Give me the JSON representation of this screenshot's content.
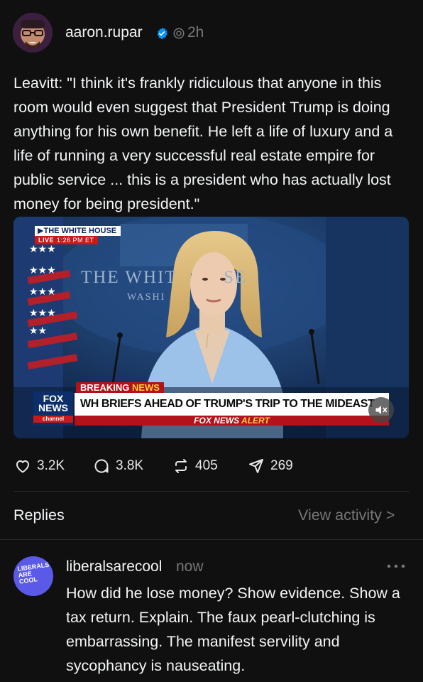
{
  "post": {
    "username": "aaron.rupar",
    "timestamp": "2h",
    "text": "Leavitt: \"I think it's frankly ridiculous that anyone in this room would even suggest that President Trump is doing anything for his own benefit. He left a life of luxury and a life of running a very successful real estate empire for public service ... this is a president who has actually lost money for being president.\"",
    "verified_icon": "verified-badge-icon",
    "accent_color": "#0095f6"
  },
  "video": {
    "location_tag": "THE WHITE HOUSE",
    "live_label": "LIVE",
    "live_time": "1:26 PM ET",
    "backdrop_text": "THE WHIT        SE",
    "backdrop_sub": "WASHI",
    "breaking_prefix": "BREAKING ",
    "breaking_word": "NEWS",
    "network_logo_line1": "FOX",
    "network_logo_line2": "NEWS",
    "network_logo_line3": "channel",
    "headline": "WH BRIEFS AHEAD OF TRUMP'S TRIP TO THE MIDEAST",
    "alert_prefix": "FOX NEWS ",
    "alert_word": "ALERT",
    "muted": true
  },
  "actions": {
    "likes": "3.2K",
    "replies": "3.8K",
    "reposts": "405",
    "shares": "269"
  },
  "replies_section": {
    "label": "Replies",
    "view_activity": "View activity >"
  },
  "reply": {
    "username": "liberalsarecool",
    "timestamp": "now",
    "avatar_text": "LIBERALS ARE COOL",
    "text": "How did he lose money? Show evidence. Show a tax return. Explain. The faux pearl-clutching is embarrassing. The manifest servility and sycophancy is nauseating."
  }
}
